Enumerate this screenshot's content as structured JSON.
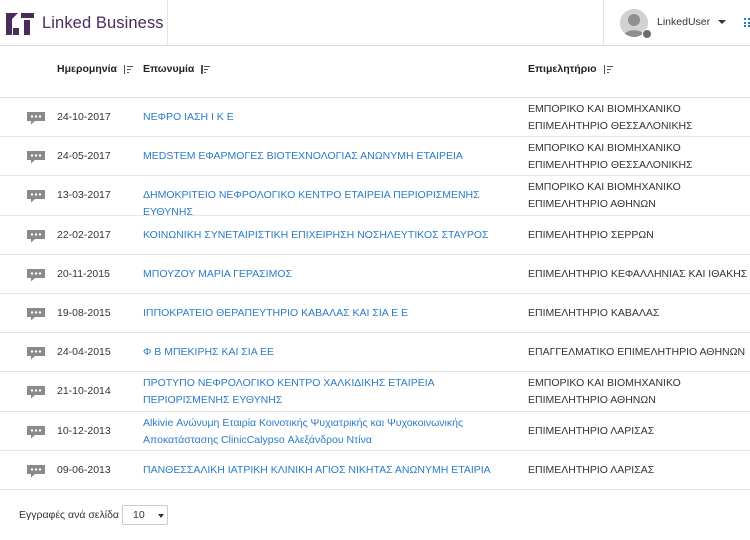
{
  "brand": {
    "name": "Linked Business",
    "color": "#4a2b5c"
  },
  "user": {
    "name": "LinkedUser"
  },
  "table": {
    "columns": [
      "Ημερομηνία",
      "Επωνυμία",
      "Επιμελητήριο"
    ],
    "rows": [
      {
        "date": "24-10-2017",
        "name": "ΝΕΦΡΟ ΙΑΣΗ Ι Κ Ε",
        "chamber": "ΕΜΠΟΡΙΚΟ ΚΑΙ ΒΙΟΜΗΧΑΝΙΚΟ ΕΠΙΜΕΛΗΤΗΡΙΟ ΘΕΣΣΑΛΟΝΙΚΗΣ"
      },
      {
        "date": "24-05-2017",
        "name": "MEDSTEM ΕΦΑΡΜΟΓΕΣ ΒΙΟΤΕΧΝΟΛΟΓΙΑΣ ΑΝΩΝΥΜΗ ΕΤΑΙΡΕΙΑ",
        "chamber": "ΕΜΠΟΡΙΚΟ ΚΑΙ ΒΙΟΜΗΧΑΝΙΚΟ ΕΠΙΜΕΛΗΤΗΡΙΟ ΘΕΣΣΑΛΟΝΙΚΗΣ"
      },
      {
        "date": "13-03-2017",
        "name": "ΔΗΜΟΚΡΙΤΕΙΟ ΝΕΦΡΟΛΟΓΙΚΟ ΚΕΝΤΡΟ ΕΤΑΙΡΕΙΑ ΠΕΡΙΟΡΙΣΜΕΝΗΣ ΕΥΘΥΝΗΣ",
        "chamber": "ΕΜΠΟΡΙΚΟ ΚΑΙ ΒΙΟΜΗΧΑΝΙΚΟ ΕΠΙΜΕΛΗΤΗΡΙΟ ΑΘΗΝΩΝ"
      },
      {
        "date": "22-02-2017",
        "name": "ΚΟΙΝΩΝΙΚΗ ΣΥΝΕΤΑΙΡΙΣΤΙΚΗ ΕΠΙΧΕΙΡΗΣΗ ΝΟΣΗΛΕΥΤΙΚΟΣ ΣΤΑΥΡΟΣ",
        "chamber": "ΕΠΙΜΕΛΗΤΗΡΙΟ ΣΕΡΡΩΝ"
      },
      {
        "date": "20-11-2015",
        "name": "ΜΠΟΥΖΟΥ ΜΑΡΙΑ ΓΕΡΑΣΙΜΟΣ",
        "chamber": "ΕΠΙΜΕΛΗΤΗΡΙΟ ΚΕΦΑΛΛΗΝΙΑΣ ΚΑΙ ΙΘΑΚΗΣ"
      },
      {
        "date": "19-08-2015",
        "name": "ΙΠΠΟΚΡΑΤΕΙΟ ΘΕΡΑΠΕΥΤΗΡΙΟ ΚΑΒΑΛΑΣ ΚΑΙ ΣΙΑ Ε Ε",
        "chamber": "ΕΠΙΜΕΛΗΤΗΡΙΟ ΚΑΒΑΛΑΣ"
      },
      {
        "date": "24-04-2015",
        "name": "Φ Β ΜΠΕΚΙΡΗΣ ΚΑΙ ΣΙΑ ΕΕ",
        "chamber": "ΕΠΑΓΓΕΛΜΑΤΙΚΟ ΕΠΙΜΕΛΗΤΗΡΙΟ ΑΘΗΝΩΝ"
      },
      {
        "date": "21-10-2014",
        "name": "ΠΡΟΤΥΠΟ ΝΕΦΡΟΛΟΓΙΚΟ ΚΕΝΤΡΟ ΧΑΛΚΙΔΙΚΗΣ ΕΤΑΙΡΕΙΑ ΠΕΡΙΟΡΙΣΜΕΝΗΣ ΕΥΘΥΝΗΣ",
        "chamber": "ΕΜΠΟΡΙΚΟ ΚΑΙ ΒΙΟΜΗΧΑΝΙΚΟ ΕΠΙΜΕΛΗΤΗΡΙΟ ΑΘΗΝΩΝ"
      },
      {
        "date": "10-12-2013",
        "name": "Alkivie Ανώνυμη Εταιρία Κοινοτικής Ψυχιατρικής και Ψυχοκοινωνικής Αποκατάστασης ClinicCalypso Αλεξάνδρου Ντίνα",
        "chamber": "ΕΠΙΜΕΛΗΤΗΡΙΟ ΛΑΡΙΣΑΣ"
      },
      {
        "date": "09-06-2013",
        "name": "ΠΑΝΘΕΣΣΑΛΙΚΗ ΙΑΤΡΙΚΗ ΚΛΙΝΙΚΗ ΑΓΙΟΣ ΝΙΚΗΤΑΣ ΑΝΩΝΥΜΗ ΕΤΑΙΡΙΑ",
        "chamber": "ΕΠΙΜΕΛΗΤΗΡΙΟ ΛΑΡΙΣΑΣ"
      }
    ]
  },
  "pagination": {
    "label": "Εγγραφές ανά σελίδα",
    "page_size": "10"
  },
  "colors": {
    "link": "#2a7cc7",
    "icon": "#8a8a8a"
  },
  "icons": {
    "row": "comment-icon",
    "sort": "sort-icon",
    "grid": "grid-icon",
    "avatar": "user-avatar-icon"
  }
}
